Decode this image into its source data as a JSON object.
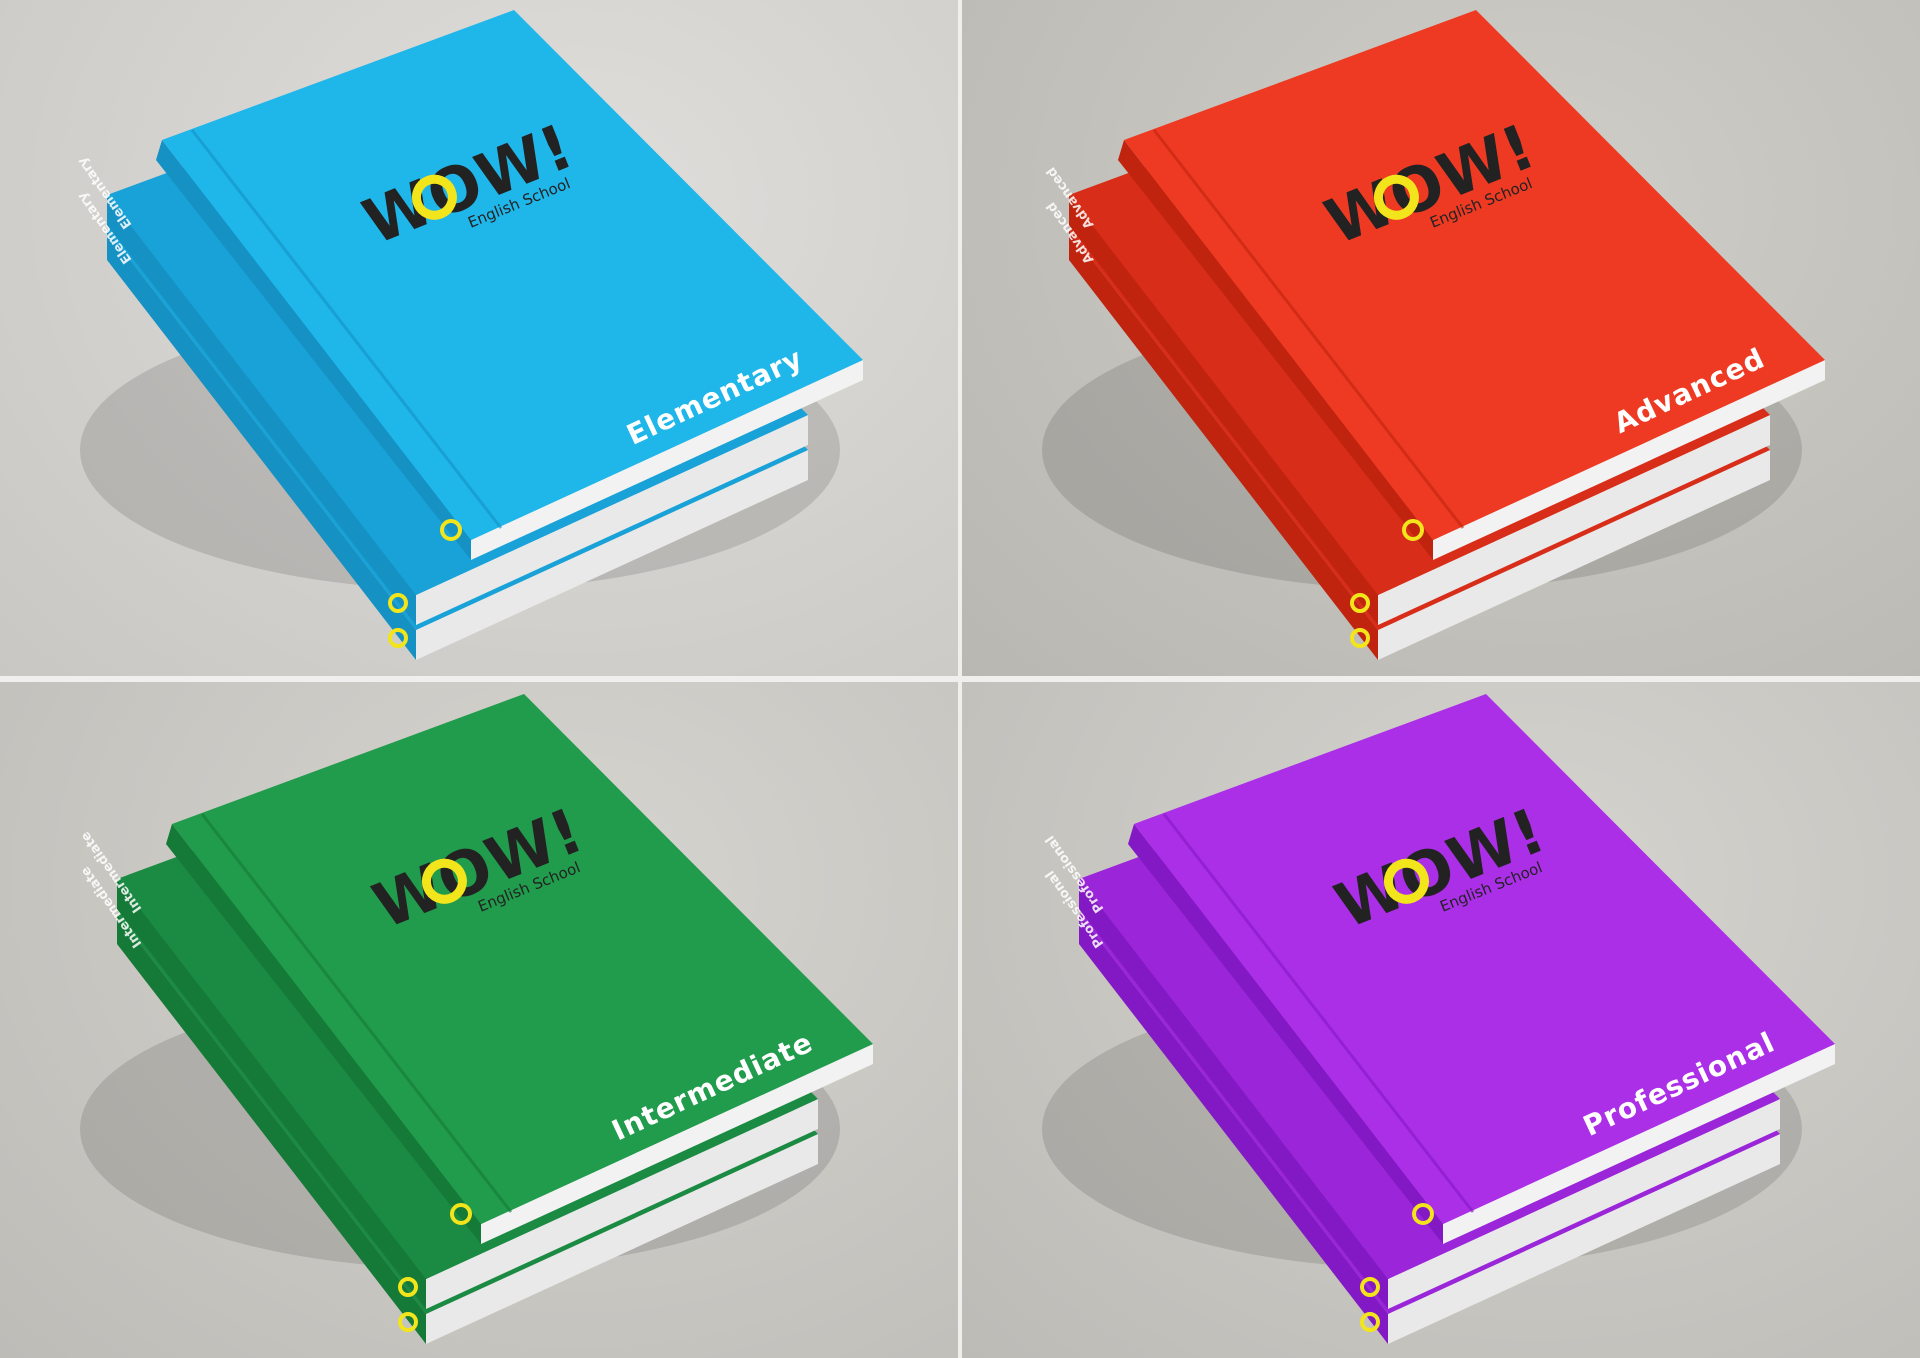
{
  "logo": {
    "wordmark": "WOW!",
    "subtitle": "English School",
    "accent_color": "#f2e51b"
  },
  "books": [
    {
      "level": "Elementary",
      "color": "#1fb6ea",
      "dark": "#1591c4",
      "spine": "#18a2d8"
    },
    {
      "level": "Advanced",
      "color": "#ee3a23",
      "dark": "#c0240f",
      "spine": "#d82d18"
    },
    {
      "level": "Intermediate",
      "color": "#219b4c",
      "dark": "#157a37",
      "spine": "#1b8a42"
    },
    {
      "level": "Professional",
      "color": "#ac2fe8",
      "dark": "#8319c4",
      "spine": "#9a25d9"
    }
  ]
}
